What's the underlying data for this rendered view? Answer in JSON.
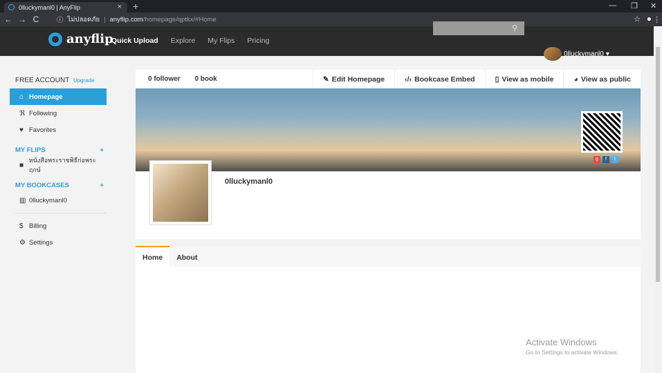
{
  "browser": {
    "tab_title": "0lluckymanl0 | AnyFlip",
    "url_info": "ไม่ปลอดภัย",
    "url_domain": "anyflip.com",
    "url_path": "/homepage/qptkx/#Home"
  },
  "header": {
    "logo_text": "anyflip",
    "nav": [
      "Quick Upload",
      "Explore",
      "My Flips",
      "Pricing"
    ],
    "search_placeholder": "",
    "username": "0lluckymanl0"
  },
  "sidebar": {
    "account": "FREE ACCOUNT",
    "upgrade": "Upgrade",
    "items": [
      {
        "label": "Homepage",
        "icon": "home-icon"
      },
      {
        "label": "Following",
        "icon": "rss-icon"
      },
      {
        "label": "Favorites",
        "icon": "heart-icon"
      }
    ],
    "my_flips": "MY FLIPS",
    "flip_item": "หนังสือพระราชพิธีก่อพระฤกษ์",
    "my_bookcases": "MY BOOKCASES",
    "bookcase_item": "0lluckymanl0",
    "billing": "Billing",
    "settings": "Settings"
  },
  "main": {
    "followers": "0 follower",
    "books": "0 book",
    "actions": [
      "Edit Homepage",
      "Bookcase Embed",
      "View as mobile",
      "View as public"
    ],
    "profile_name": "0lluckymanl0"
  },
  "panel": {
    "tabs": [
      "Home",
      "About"
    ]
  },
  "watermark": {
    "title": "Activate Windows",
    "sub": "Go to Settings to activate Windows."
  }
}
